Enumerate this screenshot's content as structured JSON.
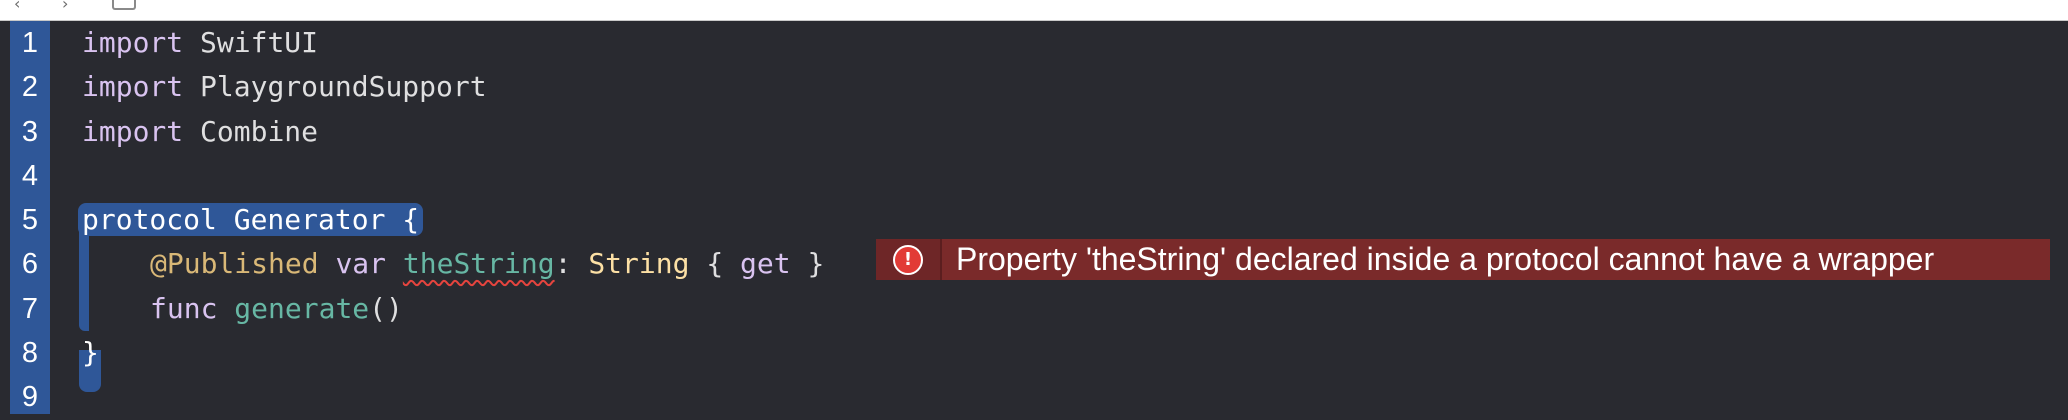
{
  "editor": {
    "lines": [
      {
        "number": "1"
      },
      {
        "number": "2"
      },
      {
        "number": "3"
      },
      {
        "number": "4"
      },
      {
        "number": "5"
      },
      {
        "number": "6"
      },
      {
        "number": "7"
      },
      {
        "number": "8"
      },
      {
        "number": "9"
      }
    ],
    "code": {
      "l1_kw": "import",
      "l1_mod": "SwiftUI",
      "l2_kw": "import",
      "l2_mod": "PlaygroundSupport",
      "l3_kw": "import",
      "l3_mod": "Combine",
      "l5_kw": "protocol",
      "l5_name": "Generator",
      "l5_brace": "{",
      "l6_attr": "@Published",
      "l6_var": "var",
      "l6_name": "theString",
      "l6_colon": ":",
      "l6_type": "String",
      "l6_open": "{",
      "l6_get": "get",
      "l6_close": "}",
      "l7_func": "func",
      "l7_name": "generate",
      "l7_parens": "()",
      "l8_brace": "}"
    }
  },
  "error": {
    "icon": "exclamation-error-icon",
    "icon_glyph": "!",
    "message": "Property 'theString' declared inside a protocol cannot have a wrapper"
  },
  "colors": {
    "background": "#292a30",
    "selection": "#2f5798",
    "keyword": "#fc5fa3",
    "error_banner": "#7a2a2a",
    "error_icon": "#e23b36"
  }
}
